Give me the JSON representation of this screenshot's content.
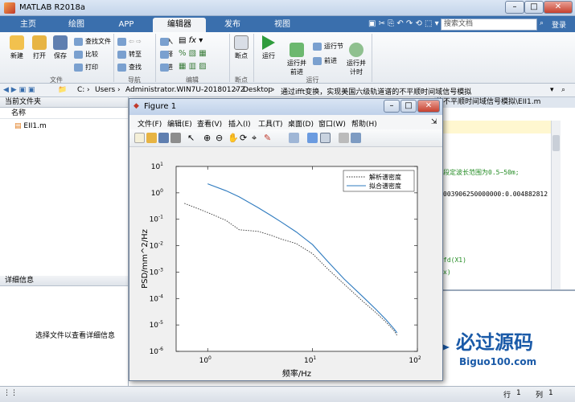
{
  "app": {
    "title": "MATLAB R2018a",
    "search_placeholder": "搜索文档",
    "login": "登录"
  },
  "tabs": [
    "主页",
    "绘图",
    "APP",
    "编辑器",
    "发布",
    "视图"
  ],
  "ribbon": {
    "file": {
      "new": "新建",
      "open": "打开",
      "save": "保存",
      "find_file": "查找文件",
      "compare": "比较",
      "print": "打印",
      "group": "文件"
    },
    "nav": {
      "goto": "转至",
      "find": "查找",
      "group": "导航"
    },
    "edit": {
      "insert": "插入",
      "comment": "注释",
      "indent": "缩进",
      "fx": "fx",
      "group": "编辑"
    },
    "breakpoint": {
      "label": "断点",
      "group": "断点"
    },
    "run": {
      "run": "运行",
      "run_advance": "运行并\n前进",
      "run_section": "运行节",
      "advance": "前进",
      "run_time": "运行并\n计时",
      "group": "运行"
    }
  },
  "address": {
    "parts": [
      "C:",
      "Users",
      "Administrator.WIN7U-20180127Z",
      "Desktop",
      "通过ifft变换，实现美国六级轨道谱的不平顺时间域信号模拟"
    ]
  },
  "panels": {
    "current_folder": "当前文件夹",
    "name_col": "名称",
    "file": "EII1.m",
    "details": "详细信息",
    "details_hint": "选择文件以查看详细信息"
  },
  "editor": {
    "path_tail": "的不平顺时间域信号模拟\\EII1.m",
    "lines": [
      "段定波长范围为0.5~50m;",
      "003906250000000:0.004882812",
      "fd(X1)",
      "x)"
    ]
  },
  "status": {
    "row_label": "行",
    "row": "1",
    "col_label": "列",
    "col": "1"
  },
  "figure": {
    "title": "Figure 1",
    "menu": [
      "文件(F)",
      "编辑(E)",
      "查看(V)",
      "插入(I)",
      "工具(T)",
      "桌面(D)",
      "窗口(W)",
      "帮助(H)"
    ]
  },
  "watermark": {
    "text": "必过源码",
    "url": "Biguo100.com"
  },
  "chart_data": {
    "type": "line",
    "xscale": "log",
    "yscale": "log",
    "xlim": [
      0.5,
      100
    ],
    "ylim": [
      1e-06,
      10
    ],
    "xticks": [
      1,
      10,
      100
    ],
    "xtick_labels": [
      "10^0",
      "10^1",
      "10^2"
    ],
    "yticks": [
      1e-06,
      1e-05,
      0.0001,
      0.001,
      0.01,
      0.1,
      1,
      10
    ],
    "ytick_labels": [
      "10^-6",
      "10^-5",
      "10^-4",
      "10^-3",
      "10^-2",
      "10^-1",
      "10^0",
      "10^1"
    ],
    "xlabel": "频率/Hz",
    "ylabel": "PSD/mm^2/Hz",
    "legend_position": "top-right",
    "series": [
      {
        "name": "解析谱密度",
        "style": "dotted",
        "color": "#333333",
        "x": [
          0.6,
          1,
          1.5,
          2,
          3,
          4,
          5,
          7,
          10,
          14,
          20,
          30,
          40,
          50,
          60,
          64
        ],
        "y": [
          0.4,
          0.18,
          0.09,
          0.04,
          0.035,
          0.025,
          0.018,
          0.012,
          0.005,
          0.0013,
          0.00035,
          8e-05,
          3e-05,
          1.3e-05,
          6e-06,
          4e-06
        ]
      },
      {
        "name": "拟合谱密度",
        "style": "solid",
        "color": "#2f7bbf",
        "x": [
          1,
          1.5,
          2,
          3,
          4,
          5,
          7,
          10,
          14,
          20,
          30,
          40,
          50,
          60,
          64
        ],
        "y": [
          2.2,
          1.2,
          0.7,
          0.28,
          0.14,
          0.08,
          0.033,
          0.011,
          0.0025,
          0.00055,
          0.00012,
          4e-05,
          1.6e-05,
          7e-06,
          5e-06
        ]
      }
    ]
  }
}
